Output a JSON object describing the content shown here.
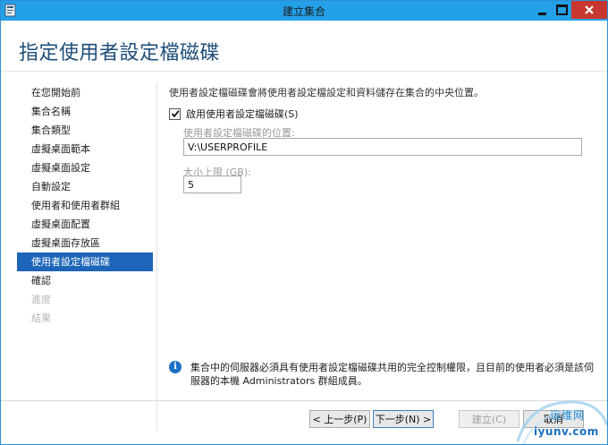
{
  "window": {
    "title": "建立集合",
    "colors": {
      "titlebar": "#24a0e8",
      "close": "#c7372f",
      "accent": "#1d65b8"
    }
  },
  "header": {
    "title": "指定使用者設定檔磁碟"
  },
  "nav": {
    "items": [
      {
        "label": "在您開始前",
        "state": "normal"
      },
      {
        "label": "集合名稱",
        "state": "normal"
      },
      {
        "label": "集合類型",
        "state": "normal"
      },
      {
        "label": "虛擬桌面範本",
        "state": "normal"
      },
      {
        "label": "虛擬桌面設定",
        "state": "normal"
      },
      {
        "label": "自動設定",
        "state": "normal"
      },
      {
        "label": "使用者和使用者群組",
        "state": "normal"
      },
      {
        "label": "虛擬桌面配置",
        "state": "normal"
      },
      {
        "label": "虛擬桌面存放區",
        "state": "normal"
      },
      {
        "label": "使用者設定檔磁碟",
        "state": "active"
      },
      {
        "label": "確認",
        "state": "normal"
      },
      {
        "label": "進度",
        "state": "disabled"
      },
      {
        "label": "結果",
        "state": "disabled"
      }
    ]
  },
  "main": {
    "description": "使用者設定檔磁碟會將使用者設定檔設定和資料儲存在集合的中央位置。",
    "enable_checkbox": {
      "label": "啟用使用者設定檔磁碟(S)",
      "checked": true
    },
    "location": {
      "label": "使用者設定檔磁碟的位置:",
      "value": "V:\\USERPROFILE"
    },
    "size": {
      "label": "大小上限 (GB):",
      "value": "5"
    },
    "info_note": "集合中的伺服器必須具有使用者設定檔磁碟共用的完全控制權限，且目前的使用者必須是該伺服器的本機 Administrators 群組成員。"
  },
  "footer": {
    "prev_label": "< 上一步(P)",
    "next_label": "下一步(N) >",
    "create_label": "建立(C)",
    "cancel_label": "取消"
  },
  "watermark": {
    "cn": "运维网",
    "url": "iyunv.com"
  },
  "icons": {
    "app": "server-manager-icon",
    "minimize": "minimize-icon",
    "maximize": "maximize-icon",
    "close": "close-icon",
    "check": "checkmark-icon",
    "info": "info-icon"
  }
}
